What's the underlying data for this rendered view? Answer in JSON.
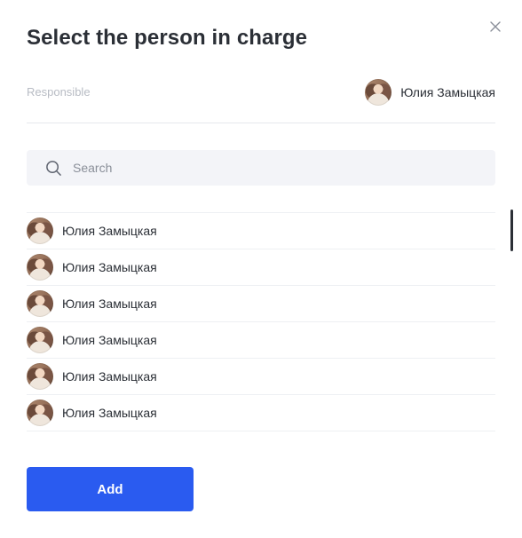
{
  "dialog": {
    "title": "Select the person in charge",
    "close_icon": "close-icon"
  },
  "responsible": {
    "label": "Responsible",
    "user_name": "Юлия Замыцкая"
  },
  "search": {
    "placeholder": "Search",
    "value": "",
    "icon": "search-icon"
  },
  "people": [
    {
      "name": "Юлия Замыцкая"
    },
    {
      "name": "Юлия Замыцкая"
    },
    {
      "name": "Юлия Замыцкая"
    },
    {
      "name": "Юлия Замыцкая"
    },
    {
      "name": "Юлия Замыцкая"
    },
    {
      "name": "Юлия Замыцкая"
    }
  ],
  "actions": {
    "add_label": "Add"
  },
  "colors": {
    "primary": "#2a5bf0",
    "text": "#2b2f36",
    "muted": "#b8bcc4",
    "search_bg": "#f3f4f8"
  }
}
